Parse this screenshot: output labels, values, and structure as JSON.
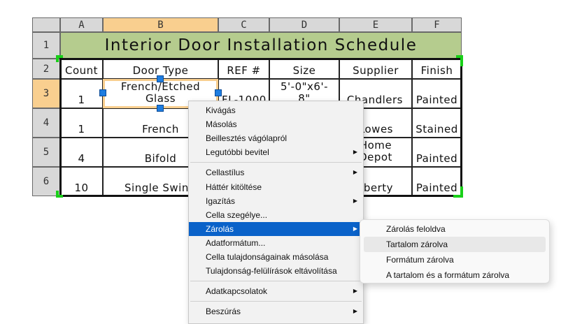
{
  "columns": [
    "A",
    "B",
    "C",
    "D",
    "E",
    "F"
  ],
  "rows": [
    "1",
    "2",
    "3",
    "4",
    "5",
    "6"
  ],
  "title": "Interior Door Installation Schedule",
  "headers": [
    "Count",
    "Door Type",
    "REF #",
    "Size",
    "Supplier",
    "Finish"
  ],
  "row3": {
    "count": "1",
    "door_type_line1": "French/Etched",
    "door_type_line2": "Glass",
    "ref": "FL-1000",
    "size_line1": "5'-0\"x6'-",
    "size_line2": "8\"",
    "supplier": "Chandlers",
    "finish": "Painted"
  },
  "row4": {
    "count": "1",
    "door_type": "French",
    "supplier": "Lowes",
    "finish": "Stained"
  },
  "row5": {
    "count": "4",
    "door_type": "Bifold",
    "supplier_line1": "Home",
    "supplier_line2": "Depot",
    "finish": "Painted"
  },
  "row6": {
    "count": "10",
    "door_type": "Single Swing",
    "supplier": "Liberty",
    "finish": "Painted"
  },
  "context_menu": {
    "items": [
      "Kivágás",
      "Másolás",
      "Beillesztés vágólapról",
      "Legutóbbi bevitel",
      "Cellastílus",
      "Háttér kitöltése",
      "Igazítás",
      "Cella szegélye...",
      "Zárolás",
      "Adatformátum...",
      "Cella tulajdonságainak másolása",
      "Tulajdonság-felülírások eltávolítása",
      "Adatkapcsolatok",
      "Beszúrás"
    ]
  },
  "submenu": {
    "items": [
      "Zárolás feloldva",
      "Tartalom zárolva",
      "Formátum zárolva",
      "A tartalom és a formátum zárolva"
    ]
  },
  "colors": {
    "title_bg": "#b5cc8e",
    "selected_header": "#f9cf8f",
    "menu_highlight": "#0a62c9",
    "corner_handles": "#19d019",
    "grips": "#1e7de0"
  },
  "icons": [
    "submenu-arrow-icon"
  ]
}
